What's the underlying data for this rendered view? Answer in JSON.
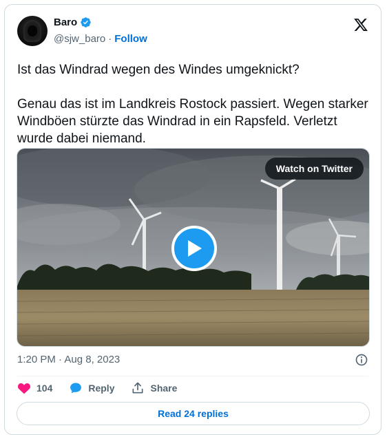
{
  "author": {
    "name": "Baro",
    "handle": "@sjw_baro",
    "separator": "·",
    "follow_label": "Follow"
  },
  "tweet": {
    "paragraphs": [
      "Ist das Windrad wegen des Windes umgeknickt?",
      "Genau das ist im Landkreis Rostock passiert. Wegen starker Windböen stürzte das Windrad in ein Rapsfeld. Verletzt wurde dabei niemand."
    ]
  },
  "media": {
    "watch_label": "Watch on Twitter"
  },
  "timestamp": "1:20 PM · Aug 8, 2023",
  "actions": {
    "like_count": "104",
    "reply_label": "Reply",
    "share_label": "Share"
  },
  "read_replies_label": "Read 24 replies",
  "colors": {
    "accent": "#1d9bf0",
    "link": "#006fd6",
    "like": "#f91880",
    "muted": "#536471"
  },
  "icons": [
    "verified-badge-icon",
    "x-logo-icon",
    "play-icon",
    "info-icon",
    "heart-icon",
    "reply-bubble-icon",
    "share-icon"
  ]
}
